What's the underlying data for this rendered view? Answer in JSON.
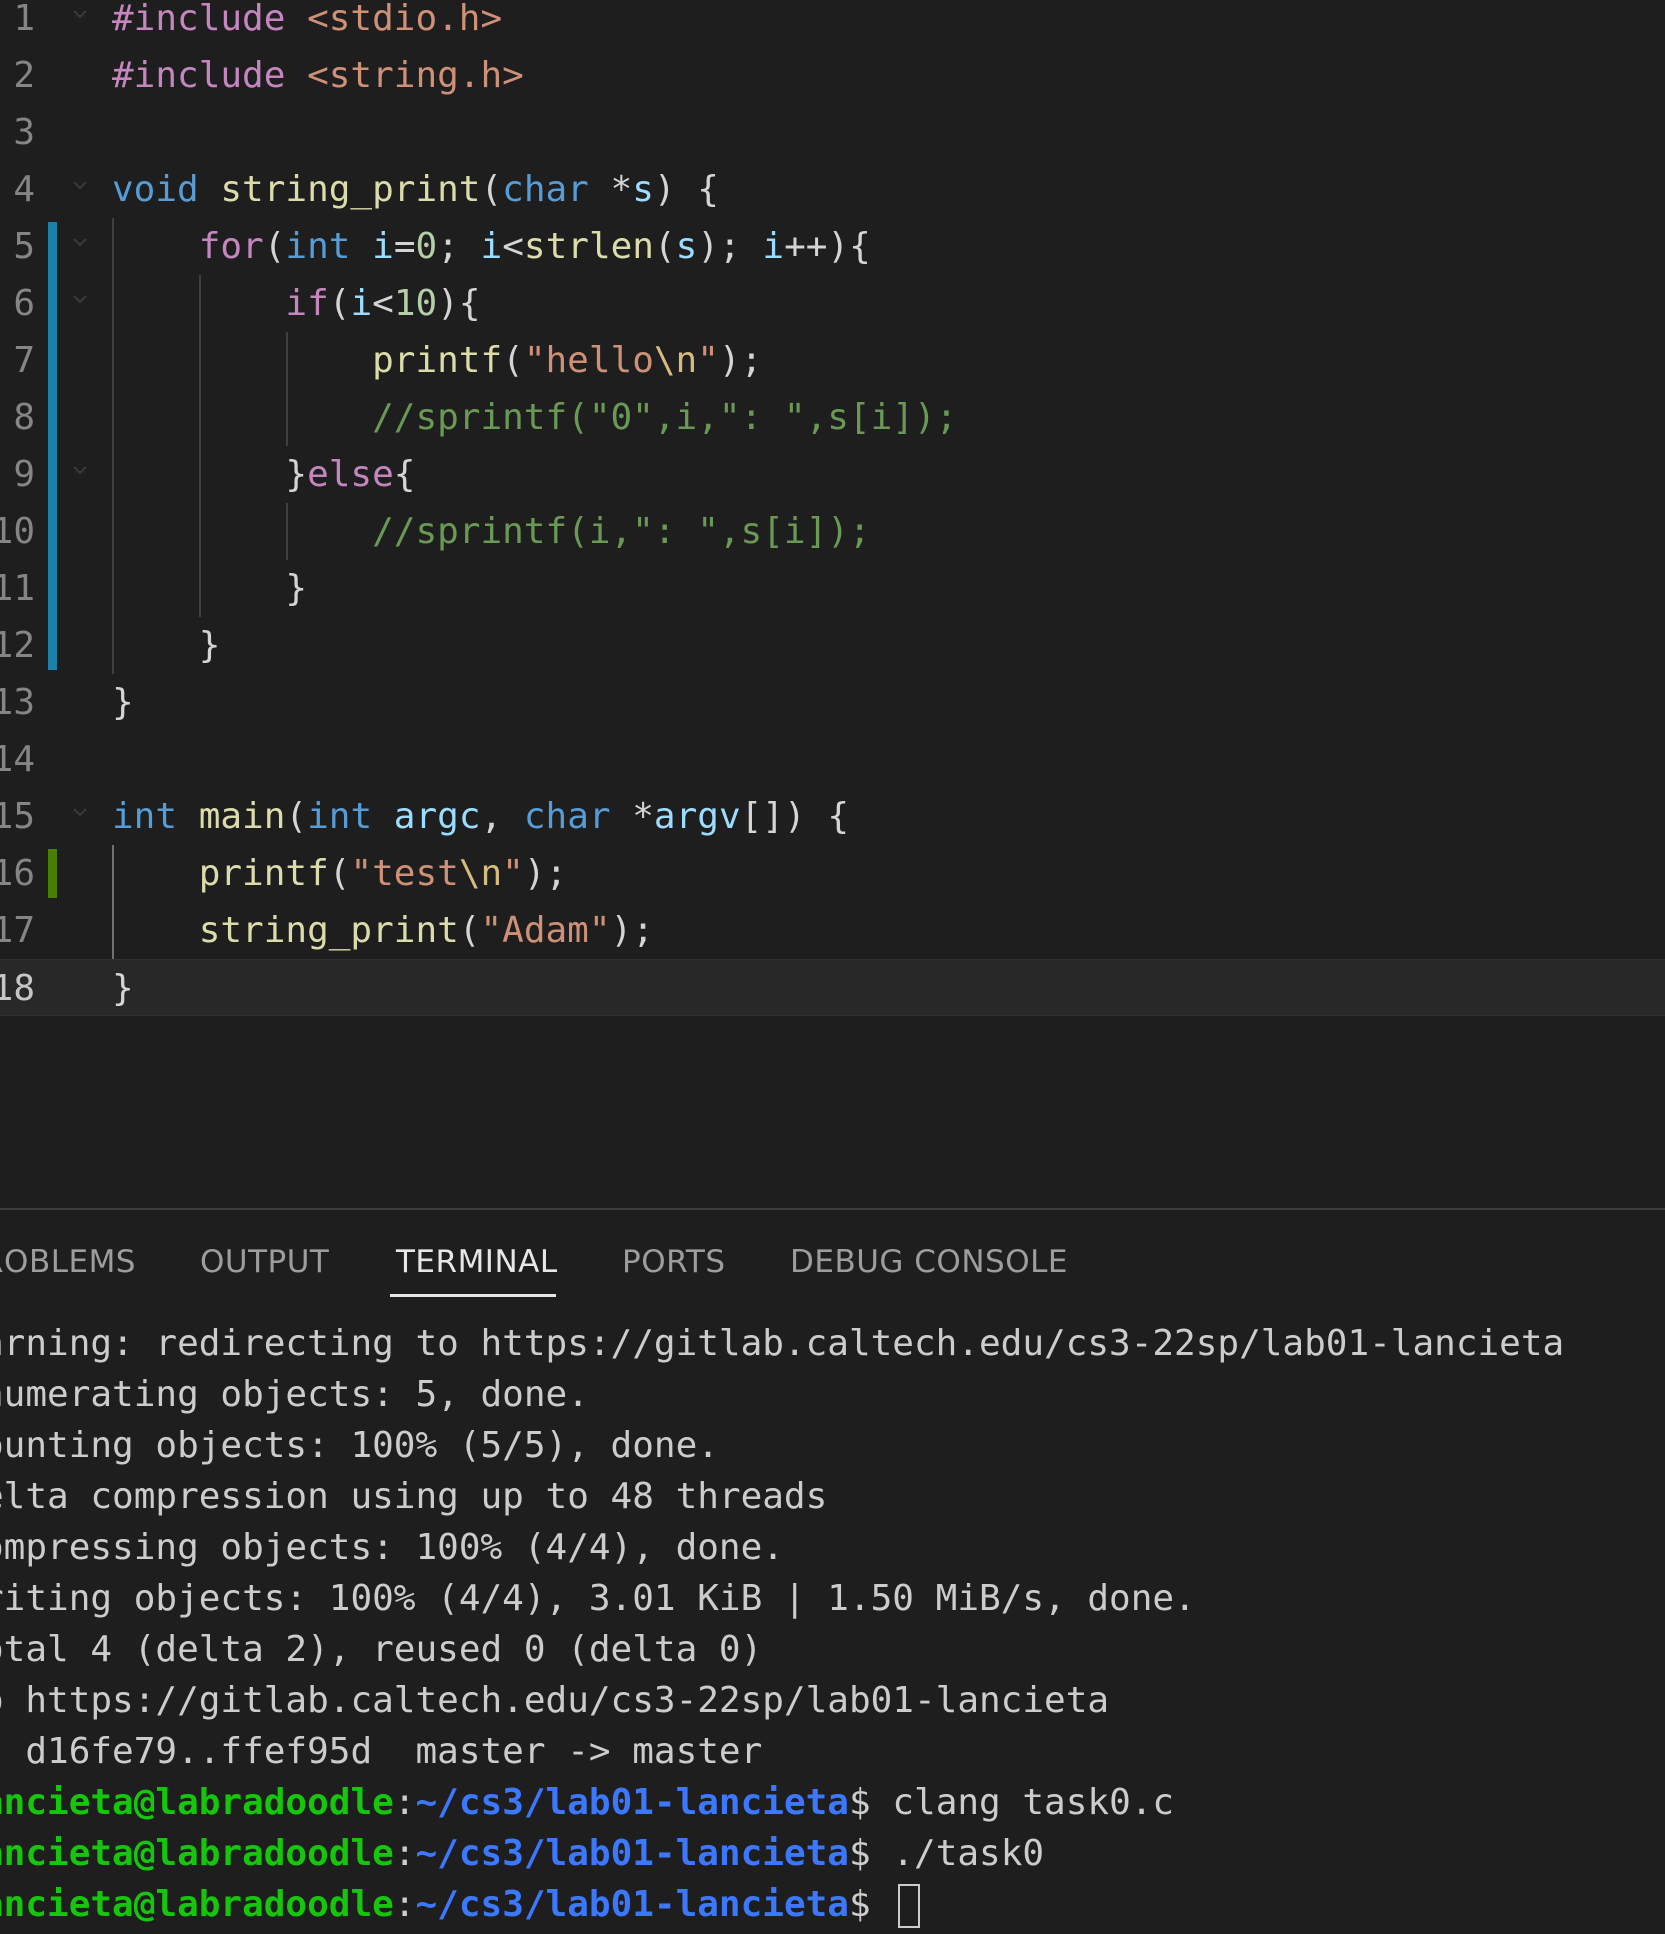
{
  "editor": {
    "line_numbers": [
      "1",
      "2",
      "3",
      "4",
      "5",
      "6",
      "7",
      "8",
      "9",
      "10",
      "11",
      "12",
      "13",
      "14",
      "15",
      "16",
      "17",
      "18"
    ],
    "lines": [
      [
        {
          "t": "#include ",
          "c": "kw-pre"
        },
        {
          "t": "<stdio.h>",
          "c": "inc"
        }
      ],
      [
        {
          "t": "#include ",
          "c": "kw-pre"
        },
        {
          "t": "<string.h>",
          "c": "inc"
        }
      ],
      [],
      [
        {
          "t": "void ",
          "c": "kw"
        },
        {
          "t": "string_print",
          "c": "fn"
        },
        {
          "t": "(",
          "c": "punc"
        },
        {
          "t": "char ",
          "c": "kw"
        },
        {
          "t": "*",
          "c": "op"
        },
        {
          "t": "s",
          "c": "var"
        },
        {
          "t": ") {",
          "c": "punc"
        }
      ],
      [
        {
          "t": "    ",
          "c": "punc"
        },
        {
          "t": "for",
          "c": "ctl"
        },
        {
          "t": "(",
          "c": "punc"
        },
        {
          "t": "int ",
          "c": "kw"
        },
        {
          "t": "i",
          "c": "var"
        },
        {
          "t": "=",
          "c": "op"
        },
        {
          "t": "0",
          "c": "num"
        },
        {
          "t": "; ",
          "c": "punc"
        },
        {
          "t": "i",
          "c": "var"
        },
        {
          "t": "<",
          "c": "op"
        },
        {
          "t": "strlen",
          "c": "fn"
        },
        {
          "t": "(",
          "c": "punc"
        },
        {
          "t": "s",
          "c": "var"
        },
        {
          "t": "); ",
          "c": "punc"
        },
        {
          "t": "i",
          "c": "var"
        },
        {
          "t": "++",
          "c": "op"
        },
        {
          "t": "){",
          "c": "punc"
        }
      ],
      [
        {
          "t": "        ",
          "c": "punc"
        },
        {
          "t": "if",
          "c": "ctl"
        },
        {
          "t": "(",
          "c": "punc"
        },
        {
          "t": "i",
          "c": "var"
        },
        {
          "t": "<",
          "c": "op"
        },
        {
          "t": "10",
          "c": "num"
        },
        {
          "t": "){",
          "c": "punc"
        }
      ],
      [
        {
          "t": "            ",
          "c": "punc"
        },
        {
          "t": "printf",
          "c": "fn"
        },
        {
          "t": "(",
          "c": "punc"
        },
        {
          "t": "\"hello",
          "c": "str"
        },
        {
          "t": "\\n",
          "c": "esc"
        },
        {
          "t": "\"",
          "c": "str"
        },
        {
          "t": ");",
          "c": "punc"
        }
      ],
      [
        {
          "t": "            ",
          "c": "punc"
        },
        {
          "t": "//sprintf(\"0\",i,\": \",s[i]);",
          "c": "cmt"
        }
      ],
      [
        {
          "t": "        }",
          "c": "punc"
        },
        {
          "t": "else",
          "c": "ctl"
        },
        {
          "t": "{",
          "c": "punc"
        }
      ],
      [
        {
          "t": "            ",
          "c": "punc"
        },
        {
          "t": "//sprintf(i,\": \",s[i]);",
          "c": "cmt"
        }
      ],
      [
        {
          "t": "        }",
          "c": "punc"
        }
      ],
      [
        {
          "t": "    }",
          "c": "punc"
        }
      ],
      [
        {
          "t": "}",
          "c": "punc"
        }
      ],
      [],
      [
        {
          "t": "int ",
          "c": "kw"
        },
        {
          "t": "main",
          "c": "fn"
        },
        {
          "t": "(",
          "c": "punc"
        },
        {
          "t": "int ",
          "c": "kw"
        },
        {
          "t": "argc",
          "c": "var"
        },
        {
          "t": ", ",
          "c": "punc"
        },
        {
          "t": "char ",
          "c": "kw"
        },
        {
          "t": "*",
          "c": "op"
        },
        {
          "t": "argv",
          "c": "var"
        },
        {
          "t": "[]",
          "c": "punc"
        },
        {
          "t": ") {",
          "c": "punc"
        }
      ],
      [
        {
          "t": "    ",
          "c": "punc"
        },
        {
          "t": "printf",
          "c": "fn"
        },
        {
          "t": "(",
          "c": "punc"
        },
        {
          "t": "\"test",
          "c": "str"
        },
        {
          "t": "\\n",
          "c": "esc"
        },
        {
          "t": "\"",
          "c": "str"
        },
        {
          "t": ");",
          "c": "punc"
        }
      ],
      [
        {
          "t": "    ",
          "c": "punc"
        },
        {
          "t": "string_print",
          "c": "fn"
        },
        {
          "t": "(",
          "c": "punc"
        },
        {
          "t": "\"Adam\"",
          "c": "str"
        },
        {
          "t": ");",
          "c": "punc"
        }
      ],
      [
        {
          "t": "}",
          "c": "punc"
        }
      ]
    ],
    "current_line": 18,
    "colors": {
      "background": "#1e1e1e",
      "modified_gutter": "#1b81a8",
      "added_gutter": "#487e02"
    }
  },
  "panel": {
    "tabs": [
      {
        "label": "ROBLEMS",
        "active": false
      },
      {
        "label": "OUTPUT",
        "active": false
      },
      {
        "label": "TERMINAL",
        "active": true
      },
      {
        "label": "PORTS",
        "active": false
      },
      {
        "label": "DEBUG CONSOLE",
        "active": false
      }
    ],
    "terminal": {
      "output_lines": [
        "arning: redirecting to https://gitlab.caltech.edu/cs3-22sp/lab01-lancieta",
        "numerating objects: 5, done.",
        "ounting objects: 100% (5/5), done.",
        "elta compression using up to 48 threads",
        "ompressing objects: 100% (4/4), done.",
        "riting objects: 100% (4/4), 3.01 KiB | 1.50 MiB/s, done.",
        "otal 4 (delta 2), reused 0 (delta 0)",
        "o https://gitlab.caltech.edu/cs3-22sp/lab01-lancieta",
        "  d16fe79..ffef95d  master -> master"
      ],
      "prompts": [
        {
          "user": "ancieta@labradoodle",
          "sep": ":",
          "path": "~/cs3/lab01-lancieta",
          "symbol": "$ ",
          "command": "clang task0.c"
        },
        {
          "user": "ancieta@labradoodle",
          "sep": ":",
          "path": "~/cs3/lab01-lancieta",
          "symbol": "$ ",
          "command": "./task0"
        },
        {
          "user": "ancieta@labradoodle",
          "sep": ":",
          "path": "~/cs3/lab01-lancieta",
          "symbol": "$ ",
          "command": ""
        }
      ],
      "colors": {
        "user": "#16c60c",
        "path": "#3b78ff",
        "text": "#cccccc"
      }
    }
  }
}
